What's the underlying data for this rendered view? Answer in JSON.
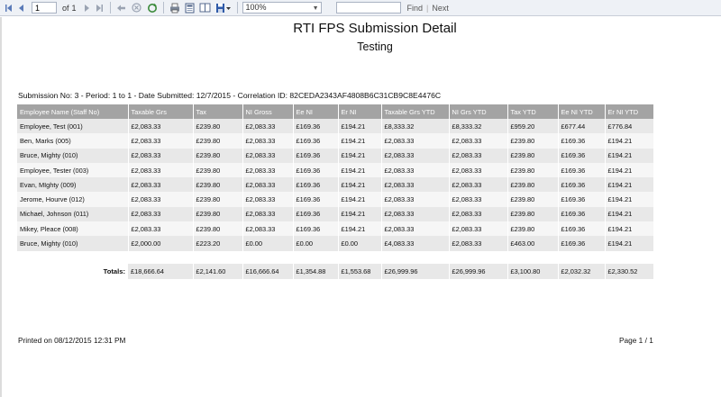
{
  "toolbar": {
    "page_current": "1",
    "page_of_label": "of",
    "page_total": "1",
    "zoom": "100%",
    "find_label": "Find",
    "next_label": "Next",
    "sep_label": "|"
  },
  "report": {
    "title": "RTI FPS Submission Detail",
    "subtitle": "Testing",
    "submission_line": "Submission No: 3 - Period: 1 to 1 - Date Submitted: 12/7/2015 - Correlation ID: 82CEDA2343AF4808B6C31CB9C8E4476C",
    "columns": [
      "Employee Name (Staff No)",
      "Taxable Grs",
      "Tax",
      "NI Gross",
      "Ee NI",
      "Er NI",
      "Taxable Grs YTD",
      "NI Grs YTD",
      "Tax YTD",
      "Ee NI YTD",
      "Er NI YTD"
    ],
    "rows": [
      [
        "Employee, Test (001)",
        "£2,083.33",
        "£239.80",
        "£2,083.33",
        "£169.36",
        "£194.21",
        "£8,333.32",
        "£8,333.32",
        "£959.20",
        "£677.44",
        "£776.84"
      ],
      [
        "Ben, Marks (005)",
        "£2,083.33",
        "£239.80",
        "£2,083.33",
        "£169.36",
        "£194.21",
        "£2,083.33",
        "£2,083.33",
        "£239.80",
        "£169.36",
        "£194.21"
      ],
      [
        "Bruce, Mighty (010)",
        "£2,083.33",
        "£239.80",
        "£2,083.33",
        "£169.36",
        "£194.21",
        "£2,083.33",
        "£2,083.33",
        "£239.80",
        "£169.36",
        "£194.21"
      ],
      [
        "Employee, Tester (003)",
        "£2,083.33",
        "£239.80",
        "£2,083.33",
        "£169.36",
        "£194.21",
        "£2,083.33",
        "£2,083.33",
        "£239.80",
        "£169.36",
        "£194.21"
      ],
      [
        "Evan, MIghty (009)",
        "£2,083.33",
        "£239.80",
        "£2,083.33",
        "£169.36",
        "£194.21",
        "£2,083.33",
        "£2,083.33",
        "£239.80",
        "£169.36",
        "£194.21"
      ],
      [
        "Jerome, Hourve (012)",
        "£2,083.33",
        "£239.80",
        "£2,083.33",
        "£169.36",
        "£194.21",
        "£2,083.33",
        "£2,083.33",
        "£239.80",
        "£169.36",
        "£194.21"
      ],
      [
        "Michael, Johnson (011)",
        "£2,083.33",
        "£239.80",
        "£2,083.33",
        "£169.36",
        "£194.21",
        "£2,083.33",
        "£2,083.33",
        "£239.80",
        "£169.36",
        "£194.21"
      ],
      [
        "Mikey, Pleace (008)",
        "£2,083.33",
        "£239.80",
        "£2,083.33",
        "£169.36",
        "£194.21",
        "£2,083.33",
        "£2,083.33",
        "£239.80",
        "£169.36",
        "£194.21"
      ],
      [
        "Bruce, Mighty (010)",
        "£2,000.00",
        "£223.20",
        "£0.00",
        "£0.00",
        "£0.00",
        "£4,083.33",
        "£2,083.33",
        "£463.00",
        "£169.36",
        "£194.21"
      ]
    ],
    "totals_label": "Totals:",
    "totals": [
      "£18,666.64",
      "£2,141.60",
      "£16,666.64",
      "£1,354.88",
      "£1,553.68",
      "£26,999.96",
      "£26,999.96",
      "£3,100.80",
      "£2,032.32",
      "£2,330.52"
    ],
    "printed_on": "Printed on 08/12/2015 12:31 PM",
    "page_info": "Page 1 / 1"
  },
  "icons": [
    "first-page-icon",
    "prev-page-icon",
    "next-page-icon",
    "last-page-icon",
    "back-icon",
    "stop-icon",
    "refresh-icon",
    "print-icon",
    "print-layout-icon",
    "page-setup-icon",
    "export-icon"
  ],
  "colors": {
    "header_bg": "#a3a3a3",
    "row_odd": "#e8e8e8",
    "row_even": "#f6f6f6",
    "toolbar_bg": "#eef1f6"
  }
}
